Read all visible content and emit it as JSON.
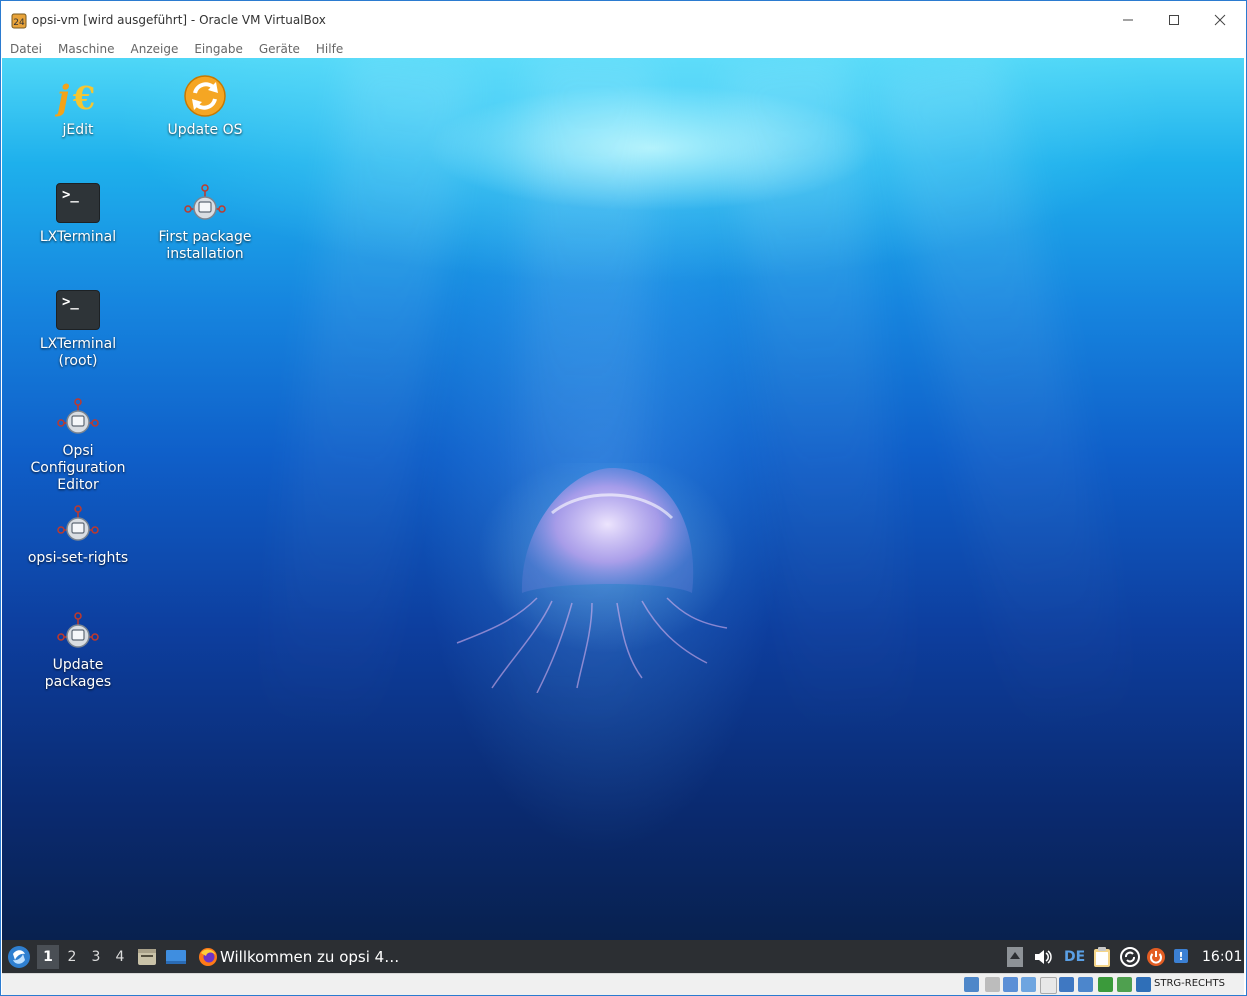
{
  "window": {
    "title": "opsi-vm [wird ausgeführt] - Oracle VM VirtualBox",
    "controls": {
      "minimize": "—",
      "maximize": "☐",
      "close": "✕"
    }
  },
  "menubar": {
    "items": [
      "Datei",
      "Maschine",
      "Anzeige",
      "Eingabe",
      "Geräte",
      "Hilfe"
    ]
  },
  "desktop": {
    "icons": [
      {
        "label": "jEdit",
        "icon": "jedit-icon"
      },
      {
        "label": "Update OS",
        "icon": "update-os-icon"
      },
      {
        "label": "LXTerminal",
        "icon": "terminal-icon"
      },
      {
        "label": "First package installation",
        "icon": "opsi-network-icon"
      },
      {
        "label": "LXTerminal (root)",
        "icon": "terminal-icon"
      },
      {
        "label": "Opsi Configuration Editor",
        "icon": "opsi-network-icon"
      },
      {
        "label": "opsi-set-rights",
        "icon": "opsi-network-icon"
      },
      {
        "label": "Update packages",
        "icon": "opsi-network-icon"
      }
    ],
    "terminal_prompt": ">_"
  },
  "taskbar": {
    "desktops": [
      "1",
      "2",
      "3",
      "4"
    ],
    "active_desktop": "1",
    "task_title": "Willkommen zu opsi 4…",
    "keyboard_layout": "DE",
    "clock": "16:01"
  },
  "statusbar": {
    "host_key": "STRG-RECHTS"
  },
  "colors": {
    "taskbar_bg": "#2c2f33",
    "accent_blue": "#2b7bd0",
    "desktop_top": "#4fd7f7",
    "desktop_bottom": "#08214f"
  }
}
